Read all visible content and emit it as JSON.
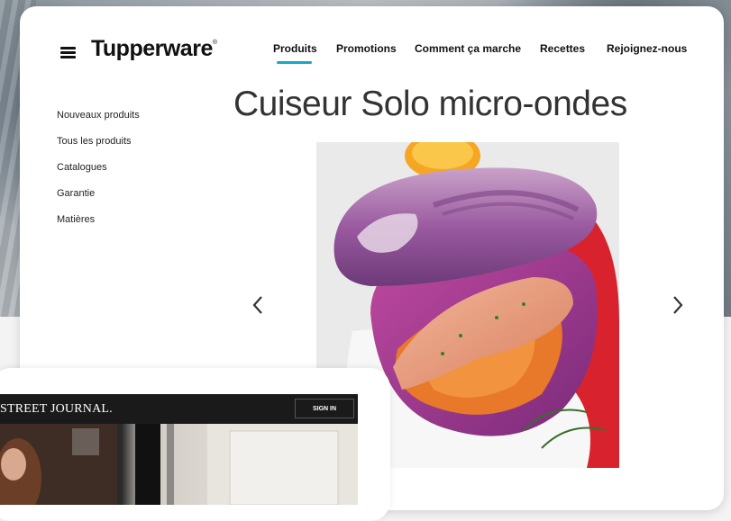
{
  "site": {
    "logo": "Tupperware",
    "logo_mark": "®",
    "nav": [
      "Produits",
      "Promotions",
      "Comment ça marche",
      "Recettes",
      "Rejoignez-nous"
    ],
    "active_nav": "Produits",
    "accent_color": "#14a8c9"
  },
  "sidebar": {
    "items": [
      "Nouveaux produits",
      "Tous les produits",
      "Catalogues",
      "Garantie",
      "Matières"
    ]
  },
  "product": {
    "title": "Cuiseur Solo micro-ondes",
    "lid_color": "#9a5aa0"
  },
  "carousel": {
    "prev_icon": "chevron-left-icon",
    "next_icon": "chevron-right-icon"
  },
  "overlay": {
    "publication": "STREET JOURNAL.",
    "sign_in_label": "SIGN IN"
  }
}
